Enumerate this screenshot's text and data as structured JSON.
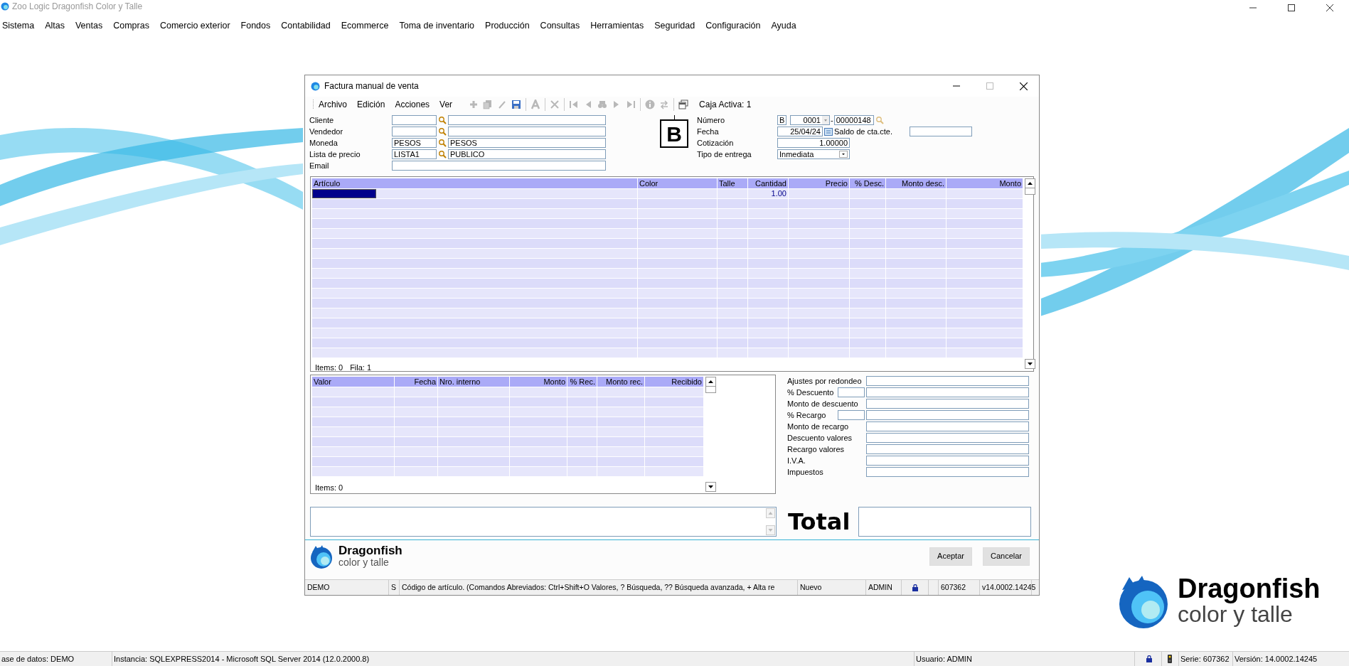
{
  "app": {
    "title": "Zoo Logic Dragonfish Color y Talle"
  },
  "menu": [
    "Sistema",
    "Altas",
    "Ventas",
    "Compras",
    "Comercio exterior",
    "Fondos",
    "Contabilidad",
    "Ecommerce",
    "Toma de inventario",
    "Producción",
    "Consultas",
    "Herramientas",
    "Seguridad",
    "Configuración",
    "Ayuda"
  ],
  "dialog": {
    "title": "Factura manual de venta",
    "menu": [
      "Archivo",
      "Edición",
      "Acciones",
      "Ver"
    ],
    "caja": "Caja Activa: 1",
    "left_fields": [
      {
        "label": "Cliente",
        "kind": "lookup"
      },
      {
        "label": "Vendedor",
        "kind": "lookup"
      },
      {
        "label": "Moneda",
        "kind": "lookup",
        "code": "PESOS",
        "description": "PESOS"
      },
      {
        "label": "Lista de precio",
        "kind": "lookup",
        "code": "LISTA1",
        "description": "PUBLICO"
      },
      {
        "label": "Email",
        "kind": "text"
      }
    ],
    "letter": "B",
    "numero": {
      "label": "Número",
      "letter": "B",
      "point": "0001",
      "separator": "-",
      "number": "00000148"
    },
    "fecha": {
      "label": "Fecha",
      "value": "25/04/24"
    },
    "saldo": {
      "label": "Saldo de cta.cte."
    },
    "cotizacion": {
      "label": "Cotización",
      "value": "1.00000"
    },
    "entrega": {
      "label": "Tipo de entrega",
      "value": "Inmediata"
    },
    "items_grid": {
      "columns": [
        "Artículo",
        "Color",
        "Talle",
        "Cantidad",
        "Precio",
        "% Desc.",
        "Monto desc.",
        "Monto"
      ],
      "first_row": {
        "cantidad": "1.00"
      },
      "footer": [
        "Items: 0",
        "Fila: 1"
      ]
    },
    "values_grid": {
      "columns": [
        "Valor",
        "Fecha",
        "Nro. interno",
        "Monto",
        "% Rec.",
        "Monto rec.",
        "Recibido"
      ],
      "footer": "Items: 0"
    },
    "totals": [
      {
        "label": "Ajustes por redondeo",
        "kind": "single"
      },
      {
        "label": "% Descuento",
        "kind": "double"
      },
      {
        "label": "Monto de descuento",
        "kind": "single"
      },
      {
        "label": "% Recargo",
        "kind": "double"
      },
      {
        "label": "Monto de recargo",
        "kind": "single"
      },
      {
        "label": "Descuento valores",
        "kind": "single"
      },
      {
        "label": "Recargo valores",
        "kind": "single"
      },
      {
        "label": "I.V.A.",
        "kind": "single"
      },
      {
        "label": "Impuestos",
        "kind": "single"
      }
    ],
    "total_label": "Total",
    "logo": {
      "name": "Dragonfish",
      "tagline": "color y talle"
    },
    "buttons": [
      "Aceptar",
      "Cancelar"
    ],
    "status": [
      "DEMO",
      "S",
      "Código de artículo. (Comandos Abreviados: Ctrl+Shift+O Valores, ? Búsqueda, ?? Búsqueda avanzada, + Alta re",
      "Nuevo",
      "ADMIN",
      "607362",
      "v14.0002.14245"
    ]
  },
  "brand": {
    "name": "Dragonfish",
    "tagline": "color y talle"
  },
  "status_bar": {
    "database": "ase de datos: DEMO",
    "instance": "Instancia: SQLEXPRESS2014 - Microsoft SQL Server 2014 (12.0.2000.8)",
    "user": "Usuario: ADMIN",
    "serie": "Serie: 607362",
    "version": "Versión: 14.0002.14245"
  }
}
